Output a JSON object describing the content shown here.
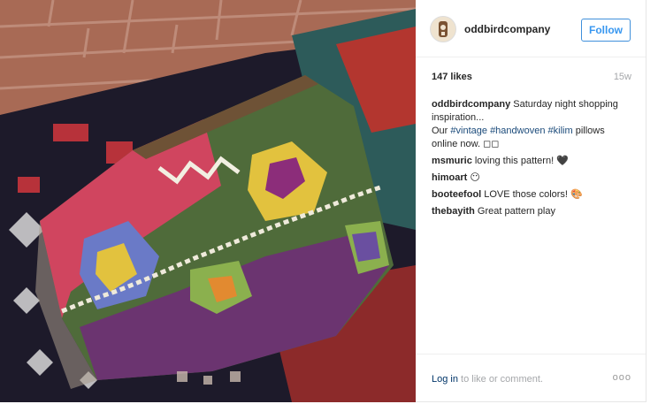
{
  "post": {
    "username": "oddbirdcompany",
    "follow_label": "Follow",
    "likes": "147 likes",
    "time_ago": "15w",
    "caption": {
      "author": "oddbirdcompany",
      "line1": "Saturday night shopping inspiration...",
      "our": "Our",
      "tag1": "#vintage",
      "tag2": "#handwoven",
      "tag3": "#kilim",
      "rest": "pillows online now. ◻◻"
    },
    "comments": [
      {
        "author": "msmuric",
        "text": "loving this pattern! 🖤"
      },
      {
        "author": "himoart",
        "text": "😶"
      },
      {
        "author": "booteefool",
        "text": "LOVE those colors! 🎨"
      },
      {
        "author": "thebayith",
        "text": "Great pattern play"
      }
    ],
    "footer": {
      "login_link": "Log in",
      "login_rest": " to like or comment.",
      "more": "ooo"
    }
  },
  "colors": {
    "link_blue": "#3897f0",
    "muted": "#a5a7aa",
    "hashtag": "#1a4a7a"
  }
}
